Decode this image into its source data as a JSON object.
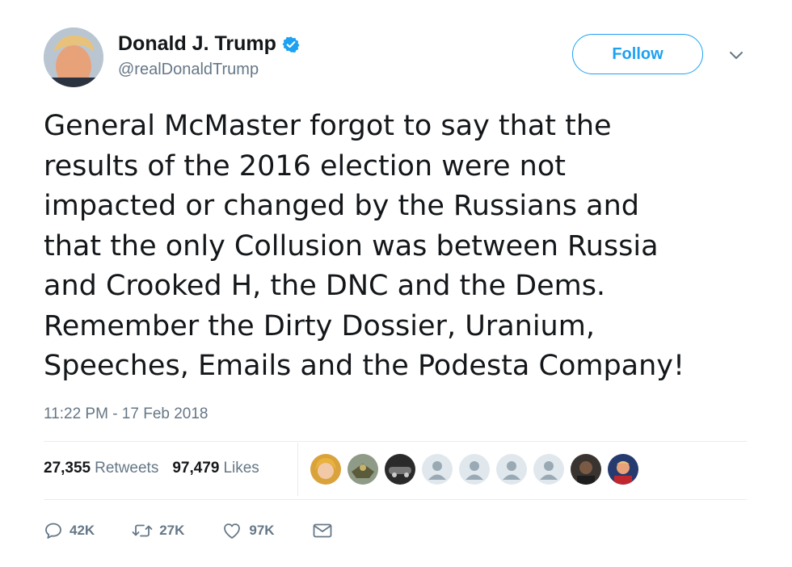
{
  "tweet": {
    "author_name": "Donald J. Trump",
    "handle": "@realDonaldTrump",
    "follow_label": "Follow",
    "text_lines": [
      "General McMaster forgot to say that the",
      "results of the 2016 election were not",
      "impacted or changed by the Russians and",
      "that the only Collusion was between Russia",
      "and Crooked H, the DNC and the Dems.",
      "Remember the Dirty Dossier, Uranium,",
      "Speeches, Emails and the Podesta Company!"
    ],
    "timestamp": "11:22 PM - 17 Feb 2018"
  },
  "stats": {
    "retweets_count": "27,355",
    "retweets_label": "Retweets",
    "likes_count": "97,479",
    "likes_label": "Likes"
  },
  "actions": {
    "reply_count": "42K",
    "retweet_count": "27K",
    "like_count": "97K"
  },
  "icons": {
    "verified": "verified-badge-icon",
    "caret": "chevron-down-icon",
    "reply": "reply-icon",
    "retweet": "retweet-icon",
    "like": "heart-icon",
    "dm": "envelope-icon"
  },
  "colors": {
    "accent": "#1da1f2",
    "text": "#14171a",
    "muted": "#657786",
    "border": "#e6ecf0"
  }
}
